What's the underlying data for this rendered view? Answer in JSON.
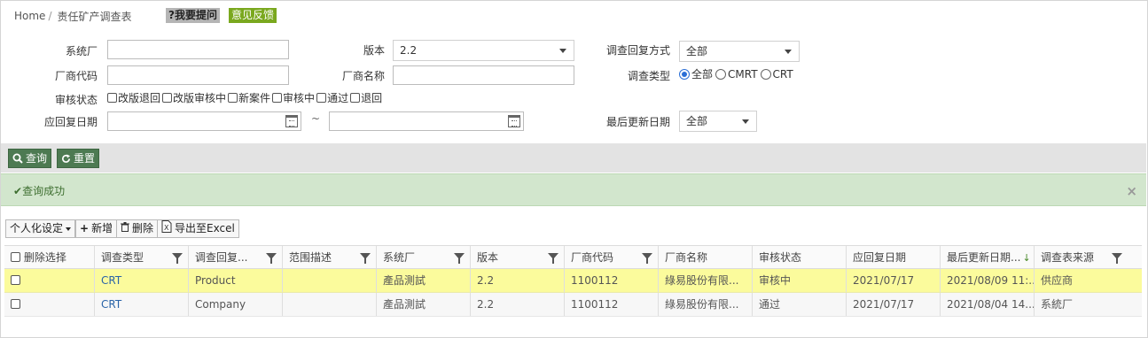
{
  "breadcrumb": {
    "home": "Home",
    "current": "责任矿产调查表"
  },
  "badges": {
    "help": "?我要提问",
    "feedback": "意见反馈"
  },
  "form": {
    "system_factory": {
      "label": "系统厂",
      "value": ""
    },
    "version": {
      "label": "版本",
      "value": "2.2"
    },
    "reply_method": {
      "label": "调查回复方式",
      "value": "全部"
    },
    "vendor_code": {
      "label": "厂商代码",
      "value": ""
    },
    "vendor_name": {
      "label": "厂商名称",
      "value": ""
    },
    "survey_type": {
      "label": "调查类型",
      "options": [
        "全部",
        "CMRT",
        "CRT"
      ],
      "selected": "全部"
    },
    "review_status": {
      "label": "审核状态",
      "options": [
        "改版退回",
        "改版审核中",
        "新案件",
        "审核中",
        "通过",
        "退回"
      ]
    },
    "reply_date": {
      "label": "应回复日期",
      "from": "",
      "to": "",
      "separator": "~"
    },
    "last_update": {
      "label": "最后更新日期",
      "value": "全部"
    }
  },
  "toolbar": {
    "query": "查询",
    "reset": "重置"
  },
  "alert": {
    "message": "查询成功",
    "close": "×"
  },
  "grid_toolbar": {
    "personalize": "个人化设定",
    "add": "新增",
    "delete": "删除",
    "export": "导出至Excel"
  },
  "table": {
    "headers": [
      "删除选择",
      "调查类型",
      "调查回复...",
      "范围描述",
      "系统厂",
      "版本",
      "厂商代码",
      "厂商名称",
      "审核状态",
      "应回复日期",
      "最后更新日期...",
      "调查表来源"
    ],
    "rows": [
      [
        "",
        "CRT",
        "Product",
        "",
        "產品測試",
        "2.2",
        "1100112",
        "綠易股份有限...",
        "审核中",
        "2021/07/17",
        "2021/08/09 11:...",
        "供应商"
      ],
      [
        "",
        "CRT",
        "Company",
        "",
        "產品測試",
        "2.2",
        "1100112",
        "綠易股份有限...",
        "通过",
        "2021/07/17",
        "2021/08/04 14...",
        "系統厂"
      ]
    ]
  },
  "colors": {
    "primary_button": "#4d7a52",
    "alert_bg": "#d2e6cd",
    "highlight_row": "#fbfb9c",
    "feedback_badge": "#7aa81e"
  }
}
